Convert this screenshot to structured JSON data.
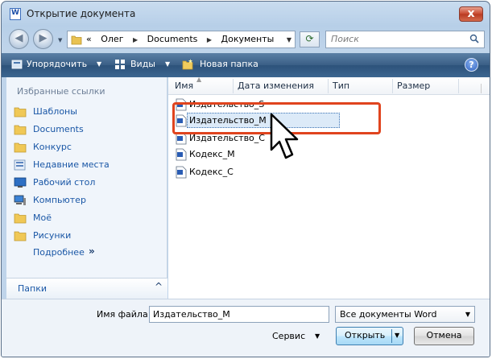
{
  "window": {
    "title": "Открытие документа",
    "close_label": "x"
  },
  "address": {
    "chevrons": "«",
    "crumbs": [
      "Олег",
      "Documents",
      "Документы"
    ],
    "search_placeholder": "Поиск"
  },
  "toolbar": {
    "organize": "Упорядочить",
    "views": "Виды",
    "new_folder": "Новая папка",
    "help": "?"
  },
  "sidebar": {
    "title": "Избранные ссылки",
    "items": [
      {
        "label": "Шаблоны",
        "icon": "folder-icon"
      },
      {
        "label": "Documents",
        "icon": "folder-icon"
      },
      {
        "label": "Конкурс",
        "icon": "folder-icon"
      },
      {
        "label": "Недавние места",
        "icon": "recent-places-icon"
      },
      {
        "label": "Рабочий стол",
        "icon": "desktop-icon"
      },
      {
        "label": "Компьютер",
        "icon": "computer-icon"
      },
      {
        "label": "Моё",
        "icon": "folder-icon"
      },
      {
        "label": "Рисунки",
        "icon": "folder-icon"
      }
    ],
    "more": "Подробнее",
    "more_chevron": "»",
    "folders": "Папки",
    "folders_chevron": "^"
  },
  "files": {
    "columns": [
      "Имя",
      "Дата изменения",
      "Тип",
      "Размер"
    ],
    "rows": [
      {
        "name": "Издательство_S"
      },
      {
        "name": "Издательство_M"
      },
      {
        "name": "Издательство_С"
      },
      {
        "name": "Кодекс_М"
      },
      {
        "name": "Кодекс_С"
      }
    ],
    "selected_index": 1
  },
  "footer": {
    "filename_label": "Имя файла:",
    "filename_value": "Издательство_М",
    "filetype_value": "Все документы Word",
    "service": "Сервис",
    "open": "Открыть",
    "cancel": "Отмена"
  },
  "colors": {
    "highlight": "#e0441e",
    "link": "#1a57a6",
    "toolbar": "#3a5f86"
  }
}
